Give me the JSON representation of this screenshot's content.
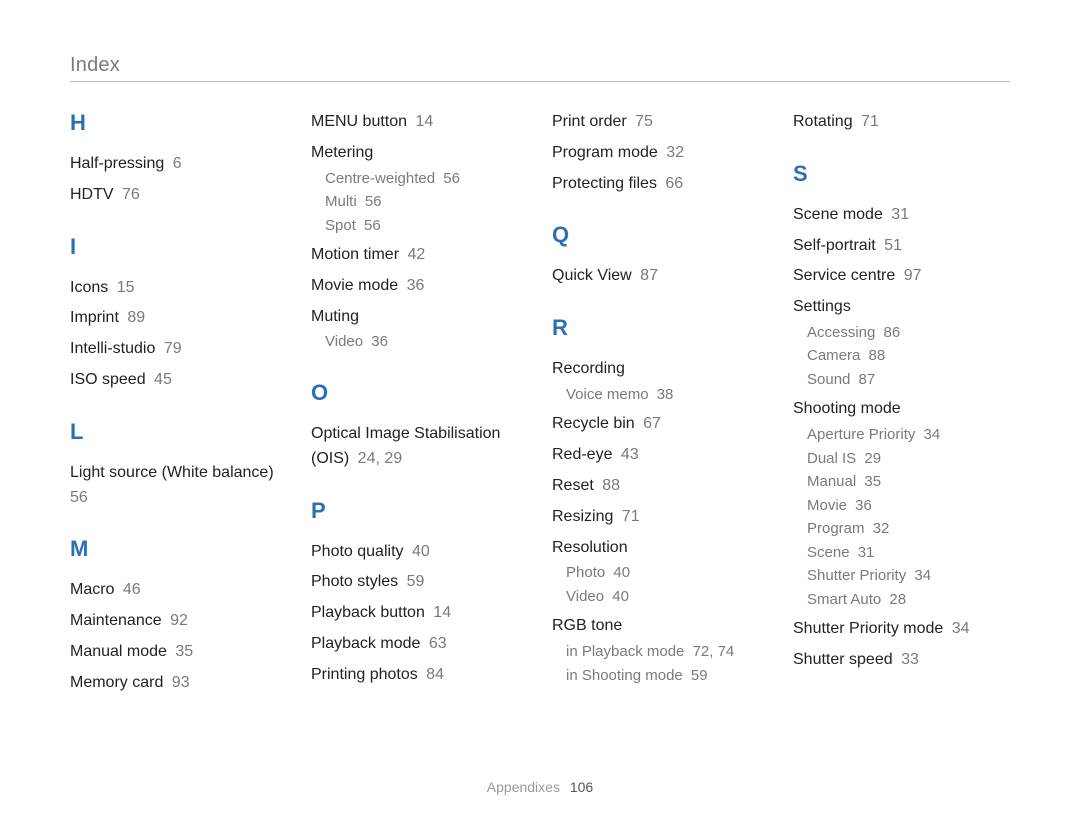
{
  "page_title": "Index",
  "footer": {
    "label": "Appendixes",
    "page": "106"
  },
  "columns": [
    [
      {
        "type": "letter",
        "text": "H",
        "first": true
      },
      {
        "type": "entry",
        "label": "Half-pressing",
        "page": "6"
      },
      {
        "type": "entry",
        "label": "HDTV",
        "page": "76"
      },
      {
        "type": "letter",
        "text": "I"
      },
      {
        "type": "entry",
        "label": "Icons",
        "page": "15"
      },
      {
        "type": "entry",
        "label": "Imprint",
        "page": "89"
      },
      {
        "type": "entry",
        "label": "Intelli-studio",
        "page": "79"
      },
      {
        "type": "entry",
        "label": "ISO speed",
        "page": "45"
      },
      {
        "type": "letter",
        "text": "L"
      },
      {
        "type": "entry",
        "label": "Light source (White balance)",
        "page": "56"
      },
      {
        "type": "letter",
        "text": "M"
      },
      {
        "type": "entry",
        "label": "Macro",
        "page": "46"
      },
      {
        "type": "entry",
        "label": "Maintenance",
        "page": "92"
      },
      {
        "type": "entry",
        "label": "Manual mode",
        "page": "35"
      },
      {
        "type": "entry",
        "label": "Memory card",
        "page": "93"
      }
    ],
    [
      {
        "type": "entry",
        "label": "MENU button",
        "page": "14",
        "first": true
      },
      {
        "type": "topic",
        "label": "Metering",
        "subs": [
          {
            "label": "Centre-weighted",
            "page": "56"
          },
          {
            "label": "Multi",
            "page": "56"
          },
          {
            "label": "Spot",
            "page": "56"
          }
        ]
      },
      {
        "type": "entry",
        "label": "Motion timer",
        "page": "42"
      },
      {
        "type": "entry",
        "label": "Movie mode",
        "page": "36"
      },
      {
        "type": "topic",
        "label": "Muting",
        "subs": [
          {
            "label": "Video",
            "page": "36"
          }
        ]
      },
      {
        "type": "letter",
        "text": "O"
      },
      {
        "type": "entry",
        "label": "Optical Image Stabilisation (OIS)",
        "page": "24, 29"
      },
      {
        "type": "letter",
        "text": "P"
      },
      {
        "type": "entry",
        "label": "Photo quality",
        "page": "40"
      },
      {
        "type": "entry",
        "label": "Photo styles",
        "page": "59"
      },
      {
        "type": "entry",
        "label": "Playback button",
        "page": "14"
      },
      {
        "type": "entry",
        "label": "Playback mode",
        "page": "63"
      },
      {
        "type": "entry",
        "label": "Printing photos",
        "page": "84"
      }
    ],
    [
      {
        "type": "entry",
        "label": "Print order",
        "page": "75",
        "first": true
      },
      {
        "type": "entry",
        "label": "Program mode",
        "page": "32"
      },
      {
        "type": "entry",
        "label": "Protecting files",
        "page": "66"
      },
      {
        "type": "letter",
        "text": "Q"
      },
      {
        "type": "entry",
        "label": "Quick View",
        "page": "87"
      },
      {
        "type": "letter",
        "text": "R"
      },
      {
        "type": "topic",
        "label": "Recording",
        "subs": [
          {
            "label": "Voice memo",
            "page": "38"
          }
        ]
      },
      {
        "type": "entry",
        "label": "Recycle bin",
        "page": "67"
      },
      {
        "type": "entry",
        "label": "Red-eye",
        "page": "43"
      },
      {
        "type": "entry",
        "label": "Reset",
        "page": "88"
      },
      {
        "type": "entry",
        "label": "Resizing",
        "page": "71"
      },
      {
        "type": "topic",
        "label": "Resolution",
        "subs": [
          {
            "label": "Photo",
            "page": "40"
          },
          {
            "label": "Video",
            "page": "40"
          }
        ]
      },
      {
        "type": "topic",
        "label": "RGB tone",
        "subs": [
          {
            "label": "in Playback mode",
            "page": "72, 74"
          },
          {
            "label": "in Shooting mode",
            "page": "59"
          }
        ]
      }
    ],
    [
      {
        "type": "entry",
        "label": "Rotating",
        "page": "71",
        "first": true
      },
      {
        "type": "letter",
        "text": "S"
      },
      {
        "type": "entry",
        "label": "Scene mode",
        "page": "31"
      },
      {
        "type": "entry",
        "label": "Self-portrait",
        "page": "51"
      },
      {
        "type": "entry",
        "label": "Service centre",
        "page": "97"
      },
      {
        "type": "topic",
        "label": "Settings",
        "subs": [
          {
            "label": "Accessing",
            "page": "86"
          },
          {
            "label": "Camera",
            "page": "88"
          },
          {
            "label": "Sound",
            "page": "87"
          }
        ]
      },
      {
        "type": "topic",
        "label": "Shooting mode",
        "subs": [
          {
            "label": "Aperture Priority",
            "page": "34"
          },
          {
            "label": "Dual IS",
            "page": "29"
          },
          {
            "label": "Manual",
            "page": "35"
          },
          {
            "label": "Movie",
            "page": "36"
          },
          {
            "label": "Program",
            "page": "32"
          },
          {
            "label": "Scene",
            "page": "31"
          },
          {
            "label": "Shutter Priority",
            "page": "34"
          },
          {
            "label": "Smart Auto",
            "page": "28"
          }
        ]
      },
      {
        "type": "entry",
        "label": "Shutter Priority mode",
        "page": "34"
      },
      {
        "type": "entry",
        "label": "Shutter speed",
        "page": "33"
      }
    ]
  ]
}
